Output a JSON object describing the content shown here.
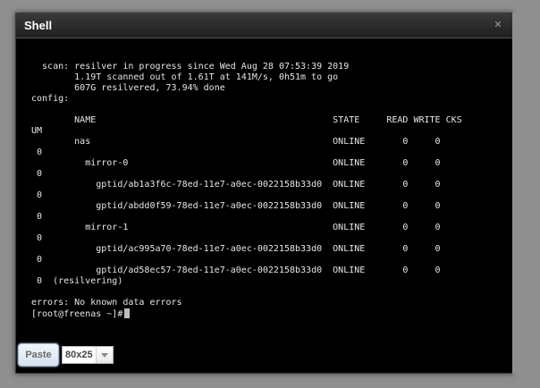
{
  "window": {
    "title": "Shell",
    "close_symbol": "✕"
  },
  "terminal": {
    "lines": [
      "  scan: resilver in progress since Wed Aug 28 07:53:39 2019",
      "        1.19T scanned out of 1.61T at 141M/s, 0h51m to go",
      "        607G resilvered, 73.94% done",
      "config:",
      "",
      "        NAME                                            STATE     READ WRITE CKS",
      "UM",
      "        nas                                             ONLINE       0     0",
      " 0",
      "          mirror-0                                      ONLINE       0     0",
      " 0",
      "            gptid/ab1a3f6c-78ed-11e7-a0ec-0022158b33d0  ONLINE       0     0",
      " 0",
      "            gptid/abdd0f59-78ed-11e7-a0ec-0022158b33d0  ONLINE       0     0",
      " 0",
      "          mirror-1                                      ONLINE       0     0",
      " 0",
      "            gptid/ac995a70-78ed-11e7-a0ec-0022158b33d0  ONLINE       0     0",
      " 0",
      "            gptid/ad58ec57-78ed-11e7-a0ec-0022158b33d0  ONLINE       0     0",
      " 0  (resilvering)",
      "",
      "errors: No known data errors",
      "[root@freenas ~]#"
    ]
  },
  "controls": {
    "paste_label": "Paste",
    "size_value": "80x25"
  }
}
